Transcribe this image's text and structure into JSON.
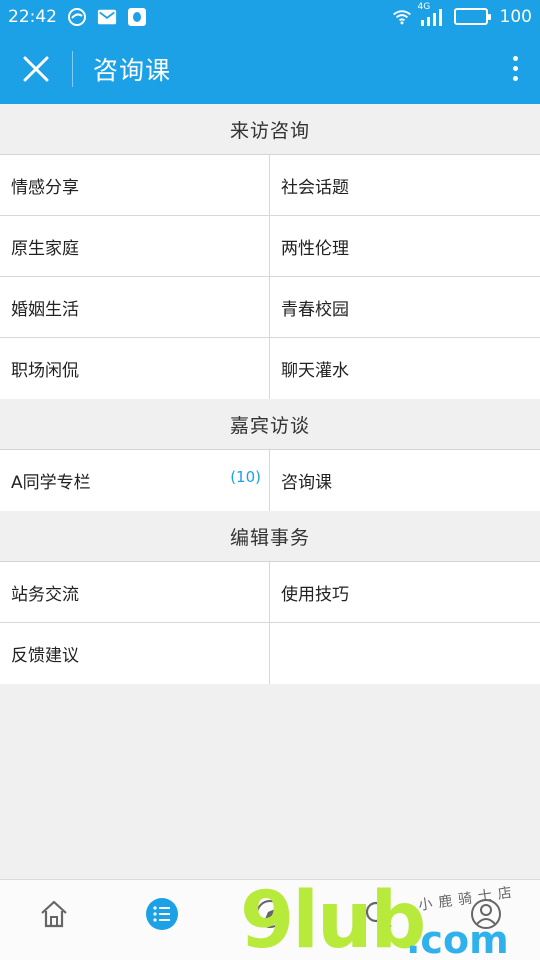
{
  "status_bar": {
    "time": "22:42",
    "network": "4G",
    "battery": "100",
    "icons": [
      "browser-icon",
      "mail-icon",
      "qq-icon",
      "wifi-icon",
      "signal-icon",
      "battery-icon"
    ]
  },
  "app_bar": {
    "title": "咨询课",
    "close_icon": "close-icon",
    "more_icon": "more-vertical-icon"
  },
  "sections": [
    {
      "header": "来访咨询",
      "rows": [
        [
          "情感分享",
          "社会话题"
        ],
        [
          "原生家庭",
          "两性伦理"
        ],
        [
          "婚姻生活",
          "青春校园"
        ],
        [
          "职场闲侃",
          "聊天灌水"
        ]
      ]
    },
    {
      "header": "嘉宾访谈",
      "rows": [
        [
          "A同学专栏",
          "咨询课"
        ]
      ],
      "badge": "(10)"
    },
    {
      "header": "编辑事务",
      "rows": [
        [
          "站务交流",
          "使用技巧"
        ],
        [
          "反馈建议",
          ""
        ]
      ]
    }
  ],
  "bottom_nav": [
    "home-icon",
    "list-icon",
    "compass-icon",
    "search-icon",
    "profile-icon"
  ],
  "colors": {
    "accent": "#1da1e6",
    "background": "#f0f0f0",
    "divider": "#d8d8d8"
  },
  "watermark": {
    "brand": "9lub",
    "domain": ".com",
    "tagline": "小鹿骑士店"
  }
}
